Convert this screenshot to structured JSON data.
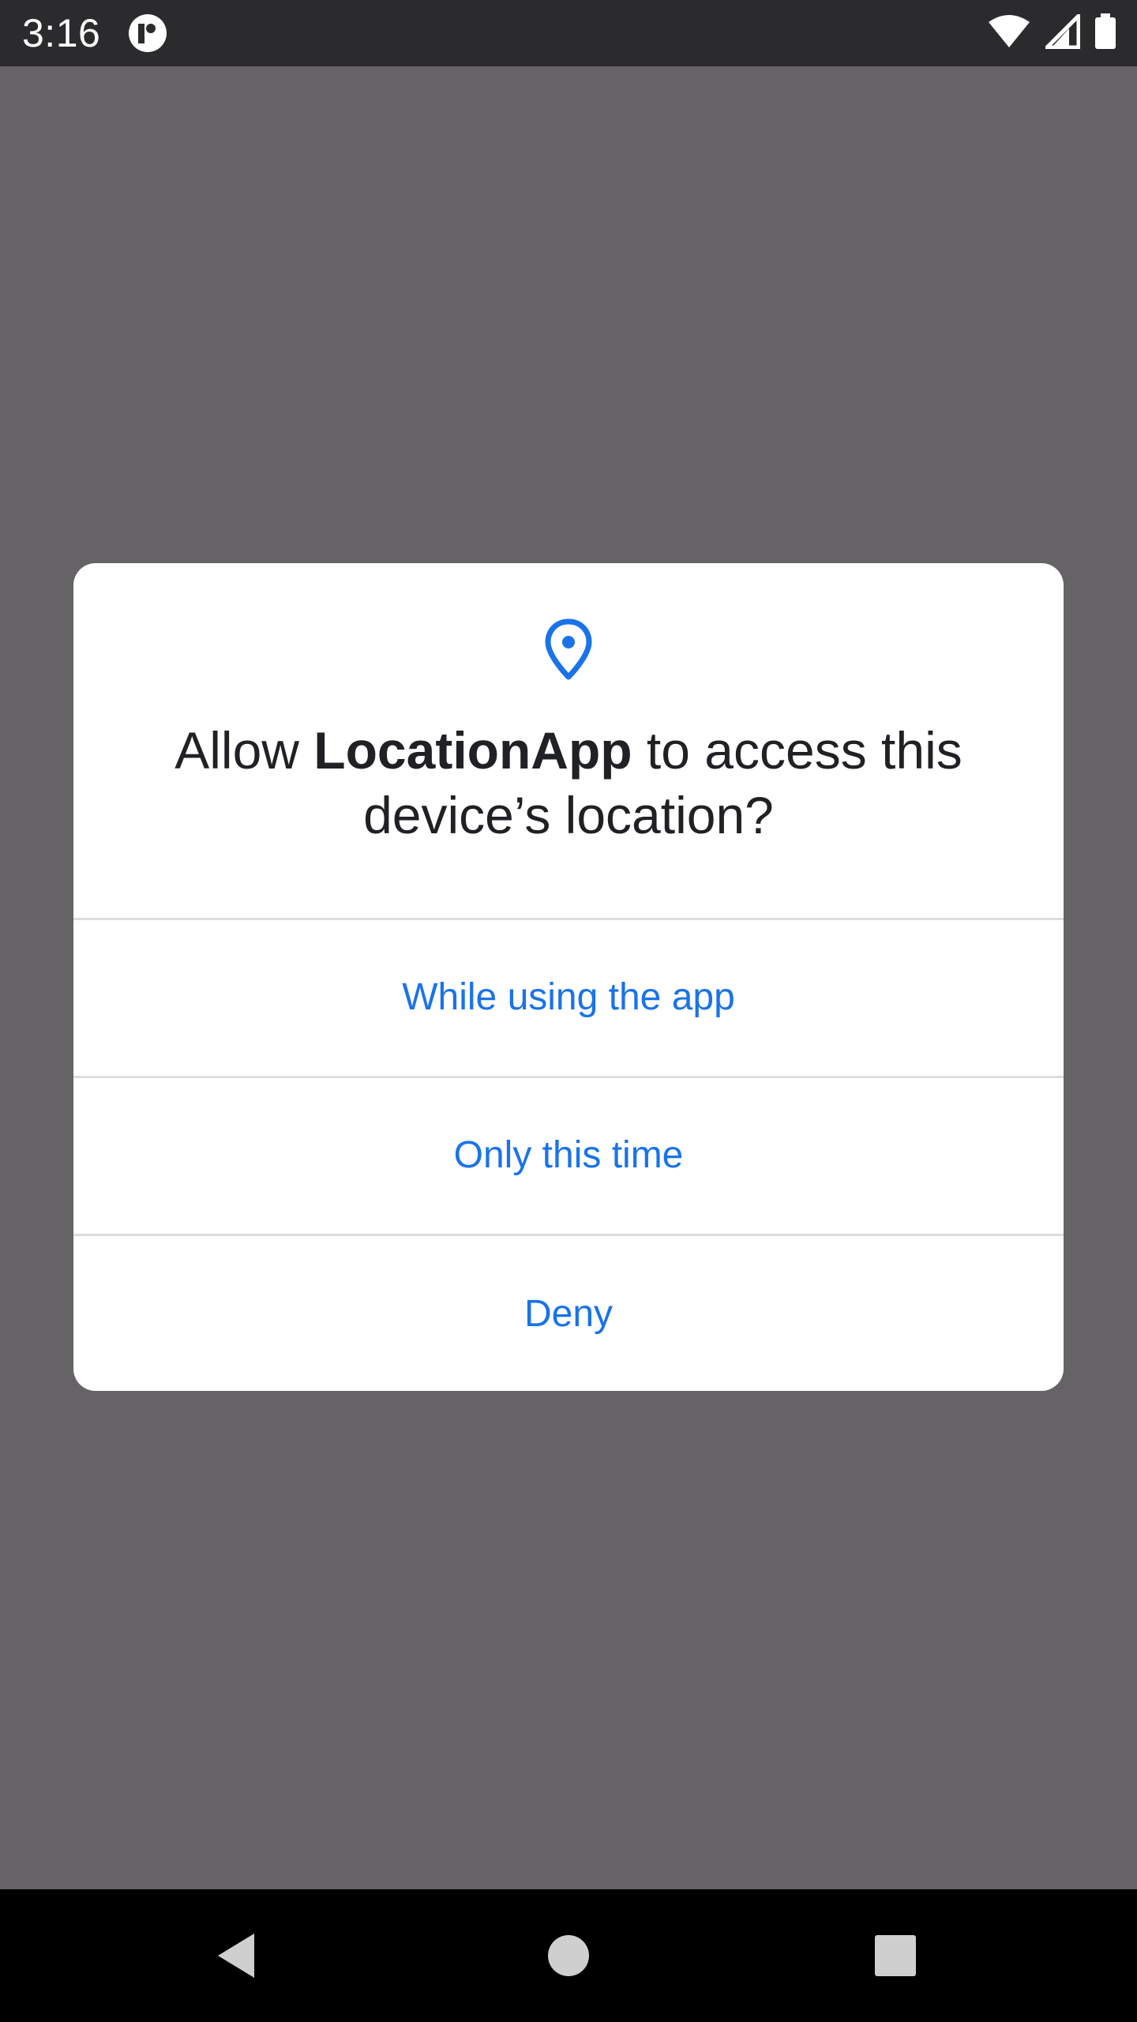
{
  "status_bar": {
    "time": "3:16",
    "app_icon": "circle-app-icon",
    "wifi_icon": "wifi-icon",
    "signal_icon": "cell-signal-icon",
    "battery_icon": "battery-icon"
  },
  "dialog": {
    "icon": "location-pin-icon",
    "title_prefix": "Allow ",
    "app_name": "LocationApp",
    "title_suffix": " to access this device’s location?",
    "options": [
      {
        "label": "While using the app"
      },
      {
        "label": "Only this time"
      },
      {
        "label": "Deny"
      }
    ]
  },
  "nav_bar": {
    "back_icon": "back-triangle-icon",
    "home_icon": "home-circle-icon",
    "recents_icon": "recents-square-icon"
  },
  "colors": {
    "accent": "#1a73e8",
    "scrim": "#656366",
    "status_bar": "#2b2b2d",
    "nav_bar": "#000000",
    "dialog_bg": "#ffffff",
    "title_text": "#202124",
    "divider": "#dcdcdc"
  }
}
